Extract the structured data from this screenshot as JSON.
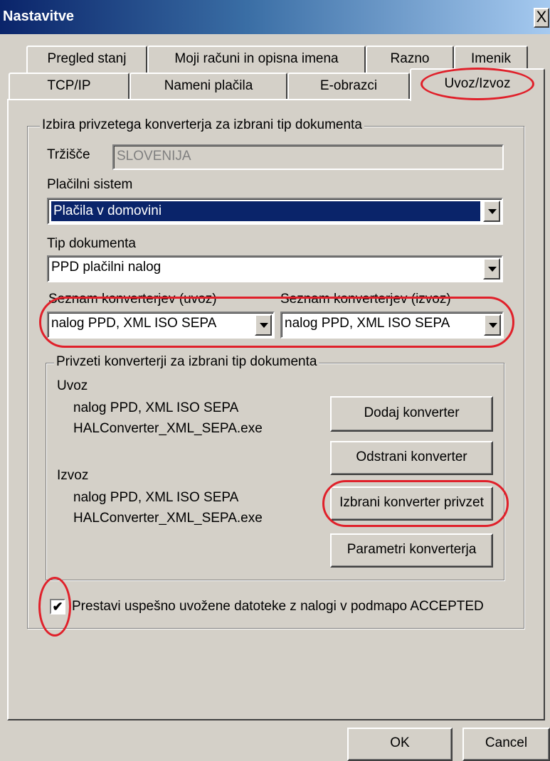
{
  "window": {
    "title": "Nastavitve",
    "close_glyph": "X"
  },
  "tabs": {
    "row1": [
      "Pregled stanj",
      "Moji računi in opisna imena",
      "Razno",
      "Imenik"
    ],
    "row2": [
      "TCP/IP",
      "Nameni plačila",
      "E-obrazci",
      "Uvoz/Izvoz"
    ],
    "active": "Uvoz/Izvoz"
  },
  "group_main": {
    "title": "Izbira privzetega konverterja za izbrani tip dokumenta",
    "market_label": "Tržišče",
    "market_value": "SLOVENIJA",
    "payment_system_label": "Plačilni sistem",
    "payment_system_value": "Plačila v domovini",
    "doc_type_label": "Tip dokumenta",
    "doc_type_value": "PPD plačilni nalog",
    "import_list_label": "Seznam konverterjev (uvoz)",
    "import_list_value": "nalog PPD, XML ISO SEPA",
    "export_list_label": "Seznam konverterjev (izvoz)",
    "export_list_value": "nalog PPD, XML ISO SEPA"
  },
  "group_default": {
    "title": "Privzeti konverterji za izbrani tip dokumenta",
    "import_heading": "Uvoz",
    "import_name": "nalog PPD, XML ISO SEPA",
    "import_exe": "HALConverter_XML_SEPA.exe",
    "export_heading": "Izvoz",
    "export_name": "nalog PPD, XML ISO SEPA",
    "export_exe": "HALConverter_XML_SEPA.exe",
    "buttons": {
      "add": "Dodaj konverter",
      "remove": "Odstrani konverter",
      "set_default": "Izbrani konverter privzet",
      "params": "Parametri konverterja"
    }
  },
  "checkbox": {
    "label": "Prestavi uspešno uvožene datoteke z nalogi v podmapo ACCEPTED",
    "checked": true,
    "mark": "✔"
  },
  "footer": {
    "ok": "OK",
    "cancel": "Cancel"
  },
  "colors": {
    "annotation": "#e0202a",
    "selection": "#0a246a",
    "face": "#d4d0c8"
  }
}
